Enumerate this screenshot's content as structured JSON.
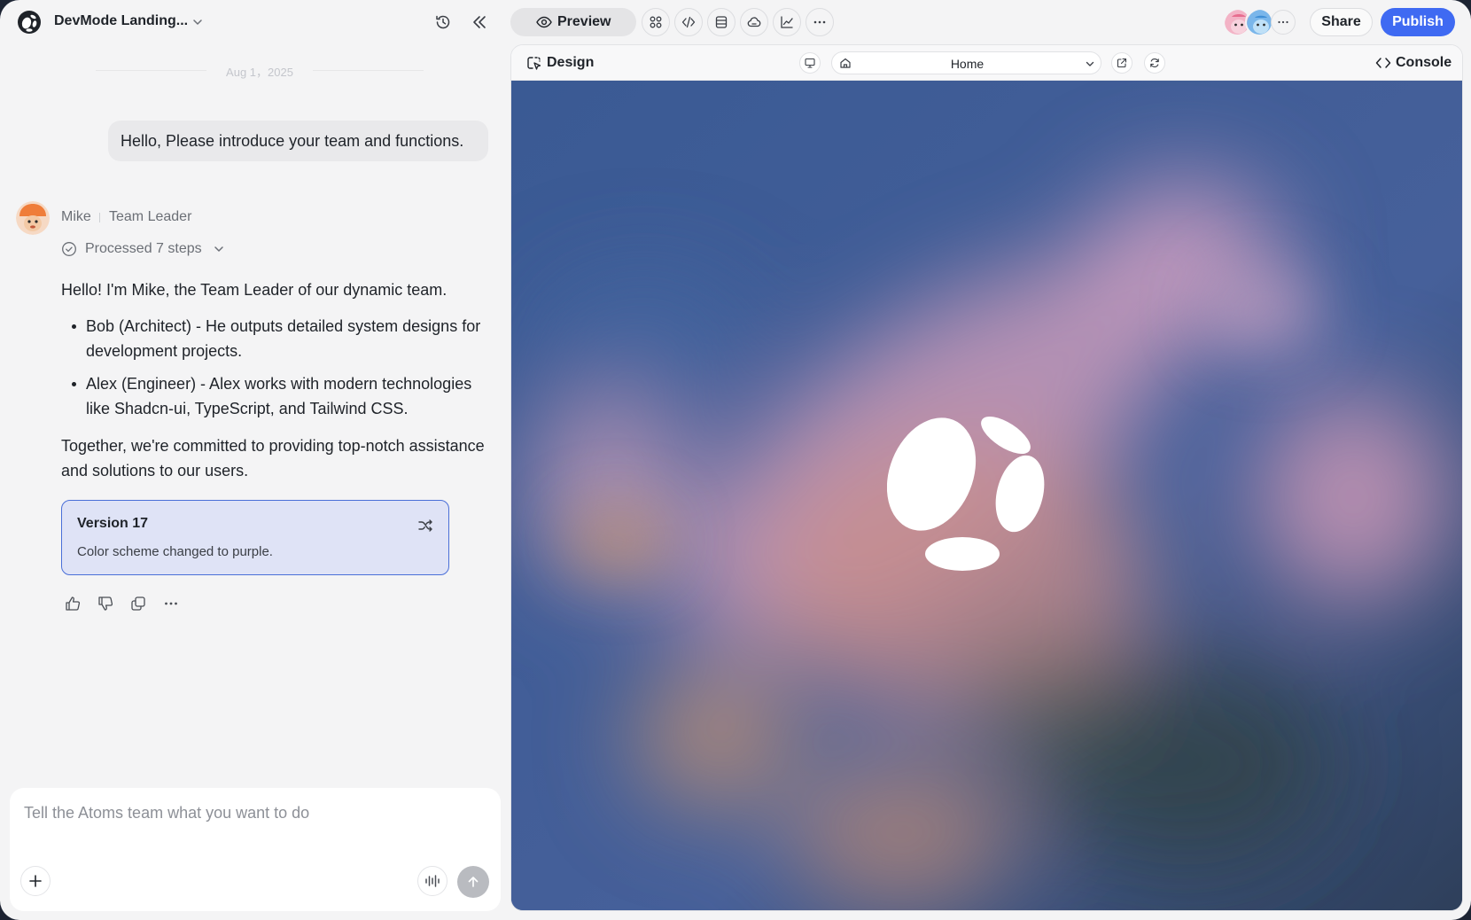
{
  "header": {
    "project_title": "DevMode Landing..."
  },
  "chat": {
    "date": "Aug 1，2025",
    "user_message": "Hello, Please introduce your team and functions.",
    "agent": {
      "name": "Mike",
      "role": "Team Leader",
      "steps_label": "Processed 7 steps"
    },
    "reply": {
      "intro": "Hello! I'm Mike, the Team Leader of our dynamic team.",
      "bullets": [
        "Bob (Architect) - He outputs detailed system designs for development projects.",
        "Alex (Engineer) - Alex works with modern technologies like Shadcn-ui, TypeScript, and Tailwind CSS."
      ],
      "outro": "Together, we're committed to providing top-notch assistance and solutions to our users."
    },
    "version_card": {
      "title": "Version 17",
      "description": "Color scheme changed to purple."
    },
    "actions": [
      "thumbs-up-icon",
      "thumbs-down-icon",
      "copy-icon",
      "more-icon"
    ]
  },
  "composer": {
    "placeholder": "Tell the Atoms team what you want to do"
  },
  "toolbar": {
    "preview_label": "Preview",
    "share_label": "Share",
    "publish_label": "Publish",
    "icons": [
      "components-icon",
      "code-icon",
      "database-icon",
      "cloud-icon",
      "analytics-icon",
      "more-icon"
    ]
  },
  "preview_frame": {
    "design_label": "Design",
    "page_select": "Home",
    "console_label": "Console"
  },
  "colors": {
    "accent": "#3f6af2",
    "version_card_bg": "#dfe3f6",
    "version_card_border": "#4a6fd8",
    "canvas_base": "#3f5d92",
    "blob_pink": "#d89bbd",
    "blob_orange": "#d89a6e"
  }
}
